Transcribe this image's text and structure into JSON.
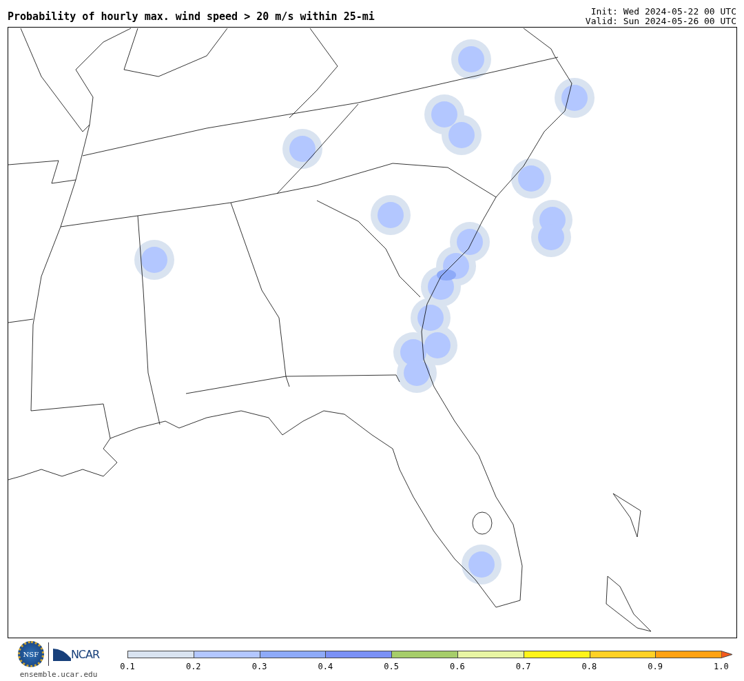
{
  "title": "Probability of hourly max. wind speed > 20 m/s within 25-mi",
  "init": "Init: Wed 2024-05-22 00 UTC",
  "valid": "Valid: Sun 2024-05-26 00 UTC",
  "footer": {
    "seal_text": "NSF",
    "logo_text": "NCAR",
    "site": "ensemble.ucar.edu"
  },
  "colorbar": {
    "bins": [
      {
        "color": "#d9e3f0"
      },
      {
        "color": "#b3c7ff"
      },
      {
        "color": "#8eaaf8"
      },
      {
        "color": "#7b91f5"
      },
      {
        "color": "#a6cd6a"
      },
      {
        "color": "#e8f5a4"
      },
      {
        "color": "#fff41a"
      },
      {
        "color": "#ffd126"
      },
      {
        "color": "#ffa213"
      }
    ],
    "extend_arrow": {
      "color": "#f45b1d"
    },
    "ticks": [
      "0.1",
      "0.2",
      "0.3",
      "0.4",
      "0.5",
      "0.6",
      "0.7",
      "0.8",
      "0.9",
      "1.0"
    ]
  }
}
